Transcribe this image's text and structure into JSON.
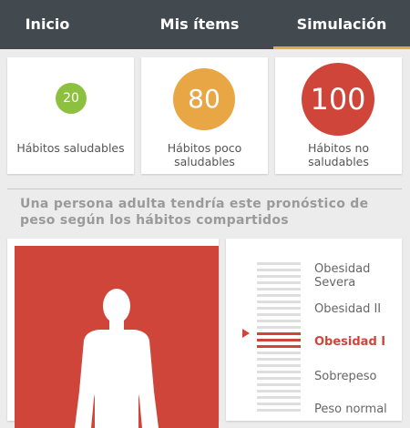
{
  "nav": {
    "tabs": [
      {
        "label": "Inicio"
      },
      {
        "label": "Mis ítems"
      },
      {
        "label": "Simulación"
      }
    ],
    "active_tab": "Simulación",
    "accent_color": "#e8a744",
    "background_color": "#434a4f"
  },
  "summary": [
    {
      "value": "20",
      "label": "Hábitos saludables",
      "color": "#8dc03f"
    },
    {
      "value": "80",
      "label": "Hábitos poco saludables",
      "color": "#e8a744"
    },
    {
      "value": "100",
      "label": "Hábitos no saludables",
      "color": "#d0453a"
    }
  ],
  "forecast_text": "Una persona adulta tendría este pronóstico de peso según los hábitos compartidos",
  "body_figure": {
    "icon": "person-silhouette-icon",
    "background_color": "#d0453a"
  },
  "weight_scale": {
    "levels": [
      {
        "label": "Obesidad Severa"
      },
      {
        "label": "Obesidad II"
      },
      {
        "label": "Obesidad I",
        "active": true
      },
      {
        "label": "Sobrepeso"
      },
      {
        "label": "Peso normal"
      }
    ],
    "active_color": "#d0453a"
  }
}
